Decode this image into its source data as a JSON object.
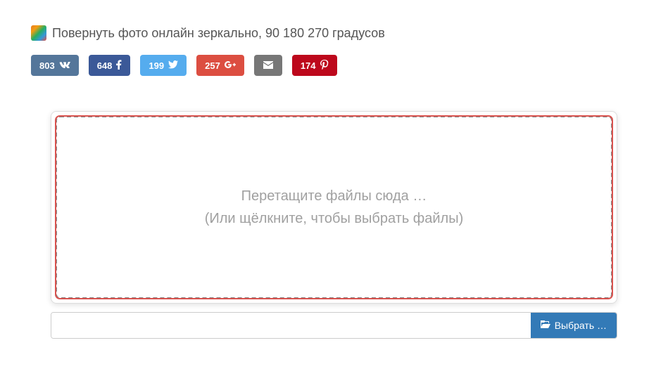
{
  "header": {
    "title": "Повернуть фото онлайн зеркально, 90 180 270 градусов"
  },
  "social": {
    "vk": {
      "count": "803",
      "icon": "vk-icon"
    },
    "fb": {
      "count": "648",
      "icon": "facebook-icon"
    },
    "tw": {
      "count": "199",
      "icon": "twitter-icon"
    },
    "gp": {
      "count": "257",
      "icon": "googleplus-icon"
    },
    "mail": {
      "icon": "mail-icon"
    },
    "pin": {
      "count": "174",
      "icon": "pinterest-icon"
    }
  },
  "dropzone": {
    "line1": "Перетащите файлы сюда …",
    "line2": "(Или щёлкните, чтобы выбрать файлы)"
  },
  "fileBar": {
    "browseLabel": "Выбрать …"
  }
}
